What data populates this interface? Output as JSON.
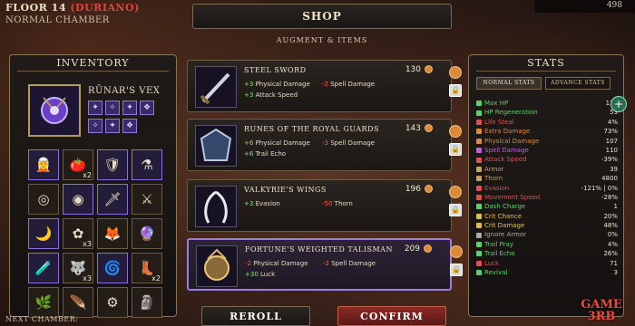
{
  "header": {
    "floor": "FLOOR 14",
    "floor_sub": "(DURIANO)",
    "chamber": "NORMAL CHAMBER",
    "currency": "498"
  },
  "shop": {
    "title": "SHOP",
    "subtitle": "AUGMENT & ITEMS"
  },
  "inventory": {
    "title": "INVENTORY",
    "featured_name": "RŪNAR'S VEX",
    "next_chamber_label": "NEXT CHAMBER:",
    "slot_counts": [
      "",
      "x2",
      "",
      "",
      "",
      "",
      "",
      "",
      "",
      "x3",
      "",
      "",
      "",
      "x3",
      "",
      "x2",
      "",
      "",
      "",
      ""
    ]
  },
  "items": [
    {
      "name": "STEEL SWORD",
      "price": "130",
      "stats": [
        {
          "v": "+3",
          "t": "Physical Damage",
          "s": "pos"
        },
        {
          "v": "-2",
          "t": "Spell Damage",
          "s": "neg"
        },
        {
          "v": "+3",
          "t": "Attack Speed",
          "s": "pos"
        }
      ]
    },
    {
      "name": "RUNES OF THE ROYAL GUARDS",
      "price": "143",
      "stats": [
        {
          "v": "+6",
          "t": "Physical Damage",
          "s": "pos"
        },
        {
          "v": "-3",
          "t": "Spell Damage",
          "s": "neg"
        },
        {
          "v": "+6",
          "t": "Trail Echo",
          "s": "pos"
        }
      ]
    },
    {
      "name": "VALKYRIE'S WINGS",
      "price": "196",
      "stats": [
        {
          "v": "+3",
          "t": "Evasion",
          "s": "pos"
        },
        {
          "v": "-50",
          "t": "Thorn",
          "s": "neg"
        }
      ]
    },
    {
      "name": "FORTUNE'S WEIGHTED TALISMAN",
      "price": "209",
      "stats": [
        {
          "v": "-2",
          "t": "Physical Damage",
          "s": "neg"
        },
        {
          "v": "-2",
          "t": "Spell Damage",
          "s": "neg"
        },
        {
          "v": "+30",
          "t": "Luck",
          "s": "pos"
        }
      ]
    }
  ],
  "stats": {
    "title": "STATS",
    "tab_normal": "NORMAL STATS",
    "tab_advance": "ADVANCE STATS",
    "rows": [
      {
        "label": "Max HP",
        "value": "131",
        "color": "#58d36a"
      },
      {
        "label": "HP Regeneration",
        "value": "53",
        "color": "#58d36a"
      },
      {
        "label": "Life Steal",
        "value": "4%",
        "color": "#e05050"
      },
      {
        "label": "Extra Damage",
        "value": "73%",
        "color": "#e08a3a"
      },
      {
        "label": "Physical Damage",
        "value": "107",
        "color": "#e08a3a"
      },
      {
        "label": "Spell Damage",
        "value": "110",
        "color": "#c060e0"
      },
      {
        "label": "Attack Speed",
        "value": "-39%",
        "color": "#e05050"
      },
      {
        "label": "Armor",
        "value": "39",
        "color": "#c8a25a"
      },
      {
        "label": "Thorn",
        "value": "4800",
        "color": "#c8a25a"
      },
      {
        "label": "Evasion",
        "value": "-121% | 0%",
        "color": "#e05050"
      },
      {
        "label": "Movement Speed",
        "value": "-28%",
        "color": "#e05050"
      },
      {
        "label": "Dash Charge",
        "value": "1",
        "color": "#58d36a"
      },
      {
        "label": "Crit Chance",
        "value": "20%",
        "color": "#e0c040"
      },
      {
        "label": "Crit Damage",
        "value": "48%",
        "color": "#e0c040"
      },
      {
        "label": "Ignore Armor",
        "value": "0%",
        "color": "#aaa"
      },
      {
        "label": "Trail Pray",
        "value": "4%",
        "color": "#58d36a"
      },
      {
        "label": "Trail Echo",
        "value": "26%",
        "color": "#58d36a"
      },
      {
        "label": "Luck",
        "value": "71",
        "color": "#e05050"
      },
      {
        "label": "Revival",
        "value": "3",
        "color": "#58d36a"
      }
    ]
  },
  "buttons": {
    "reroll": "REROLL",
    "confirm": "CONFIRM"
  },
  "watermark": {
    "line1": "GAME",
    "line2": "3RB"
  }
}
